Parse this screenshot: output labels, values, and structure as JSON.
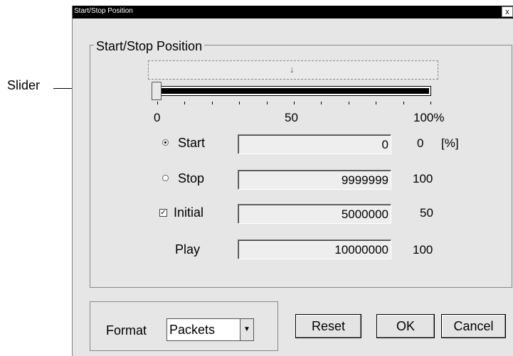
{
  "annotation": {
    "label": "Slider"
  },
  "window": {
    "title": "Start/Stop Position",
    "close_glyph": "x"
  },
  "group": {
    "legend": "Start/Stop Position"
  },
  "slider": {
    "value_percent": 0,
    "scale_labels": [
      "0",
      "50",
      "100%"
    ]
  },
  "rows": [
    {
      "control": "radio",
      "selected": true,
      "label": "Start",
      "value": "0",
      "percent": "0",
      "unit": "[%]"
    },
    {
      "control": "radio",
      "selected": false,
      "label": "Stop",
      "value": "9999999",
      "percent": "100"
    },
    {
      "control": "checkbox",
      "checked": true,
      "label": "Initial",
      "value": "5000000",
      "percent": "50"
    },
    {
      "control": "none",
      "label": "Play",
      "value": "10000000",
      "percent": "100"
    }
  ],
  "format": {
    "label": "Format",
    "selected": "Packets"
  },
  "buttons": {
    "reset": "Reset",
    "ok": "OK",
    "cancel": "Cancel"
  }
}
